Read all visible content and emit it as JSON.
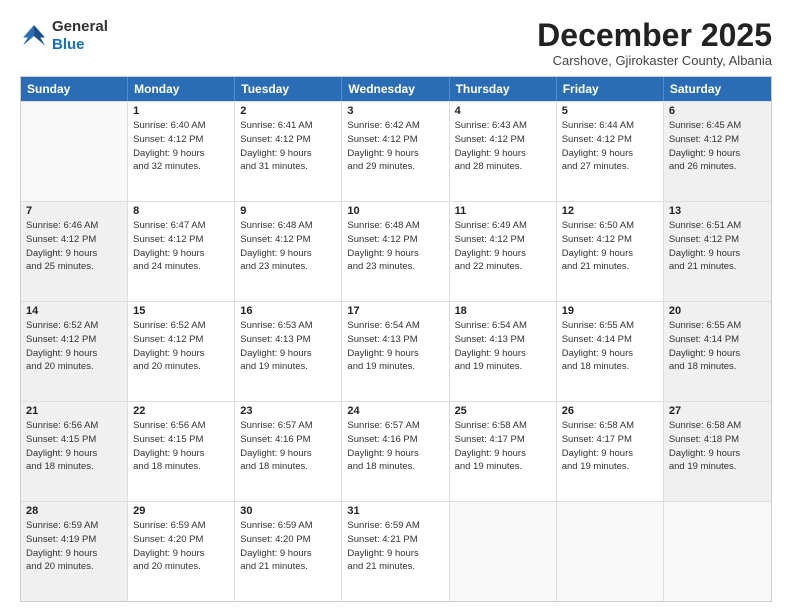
{
  "header": {
    "logo_general": "General",
    "logo_blue": "Blue",
    "month_title": "December 2025",
    "subtitle": "Carshove, Gjirokaster County, Albania"
  },
  "weekdays": [
    "Sunday",
    "Monday",
    "Tuesday",
    "Wednesday",
    "Thursday",
    "Friday",
    "Saturday"
  ],
  "rows": [
    [
      {
        "num": "",
        "info": "",
        "empty": true
      },
      {
        "num": "1",
        "info": "Sunrise: 6:40 AM\nSunset: 4:12 PM\nDaylight: 9 hours\nand 32 minutes."
      },
      {
        "num": "2",
        "info": "Sunrise: 6:41 AM\nSunset: 4:12 PM\nDaylight: 9 hours\nand 31 minutes."
      },
      {
        "num": "3",
        "info": "Sunrise: 6:42 AM\nSunset: 4:12 PM\nDaylight: 9 hours\nand 29 minutes."
      },
      {
        "num": "4",
        "info": "Sunrise: 6:43 AM\nSunset: 4:12 PM\nDaylight: 9 hours\nand 28 minutes."
      },
      {
        "num": "5",
        "info": "Sunrise: 6:44 AM\nSunset: 4:12 PM\nDaylight: 9 hours\nand 27 minutes."
      },
      {
        "num": "6",
        "info": "Sunrise: 6:45 AM\nSunset: 4:12 PM\nDaylight: 9 hours\nand 26 minutes.",
        "shaded": true
      }
    ],
    [
      {
        "num": "7",
        "info": "Sunrise: 6:46 AM\nSunset: 4:12 PM\nDaylight: 9 hours\nand 25 minutes.",
        "shaded": true
      },
      {
        "num": "8",
        "info": "Sunrise: 6:47 AM\nSunset: 4:12 PM\nDaylight: 9 hours\nand 24 minutes."
      },
      {
        "num": "9",
        "info": "Sunrise: 6:48 AM\nSunset: 4:12 PM\nDaylight: 9 hours\nand 23 minutes."
      },
      {
        "num": "10",
        "info": "Sunrise: 6:48 AM\nSunset: 4:12 PM\nDaylight: 9 hours\nand 23 minutes."
      },
      {
        "num": "11",
        "info": "Sunrise: 6:49 AM\nSunset: 4:12 PM\nDaylight: 9 hours\nand 22 minutes."
      },
      {
        "num": "12",
        "info": "Sunrise: 6:50 AM\nSunset: 4:12 PM\nDaylight: 9 hours\nand 21 minutes."
      },
      {
        "num": "13",
        "info": "Sunrise: 6:51 AM\nSunset: 4:12 PM\nDaylight: 9 hours\nand 21 minutes.",
        "shaded": true
      }
    ],
    [
      {
        "num": "14",
        "info": "Sunrise: 6:52 AM\nSunset: 4:12 PM\nDaylight: 9 hours\nand 20 minutes.",
        "shaded": true
      },
      {
        "num": "15",
        "info": "Sunrise: 6:52 AM\nSunset: 4:12 PM\nDaylight: 9 hours\nand 20 minutes."
      },
      {
        "num": "16",
        "info": "Sunrise: 6:53 AM\nSunset: 4:13 PM\nDaylight: 9 hours\nand 19 minutes."
      },
      {
        "num": "17",
        "info": "Sunrise: 6:54 AM\nSunset: 4:13 PM\nDaylight: 9 hours\nand 19 minutes."
      },
      {
        "num": "18",
        "info": "Sunrise: 6:54 AM\nSunset: 4:13 PM\nDaylight: 9 hours\nand 19 minutes."
      },
      {
        "num": "19",
        "info": "Sunrise: 6:55 AM\nSunset: 4:14 PM\nDaylight: 9 hours\nand 18 minutes."
      },
      {
        "num": "20",
        "info": "Sunrise: 6:55 AM\nSunset: 4:14 PM\nDaylight: 9 hours\nand 18 minutes.",
        "shaded": true
      }
    ],
    [
      {
        "num": "21",
        "info": "Sunrise: 6:56 AM\nSunset: 4:15 PM\nDaylight: 9 hours\nand 18 minutes.",
        "shaded": true
      },
      {
        "num": "22",
        "info": "Sunrise: 6:56 AM\nSunset: 4:15 PM\nDaylight: 9 hours\nand 18 minutes."
      },
      {
        "num": "23",
        "info": "Sunrise: 6:57 AM\nSunset: 4:16 PM\nDaylight: 9 hours\nand 18 minutes."
      },
      {
        "num": "24",
        "info": "Sunrise: 6:57 AM\nSunset: 4:16 PM\nDaylight: 9 hours\nand 18 minutes."
      },
      {
        "num": "25",
        "info": "Sunrise: 6:58 AM\nSunset: 4:17 PM\nDaylight: 9 hours\nand 19 minutes."
      },
      {
        "num": "26",
        "info": "Sunrise: 6:58 AM\nSunset: 4:17 PM\nDaylight: 9 hours\nand 19 minutes."
      },
      {
        "num": "27",
        "info": "Sunrise: 6:58 AM\nSunset: 4:18 PM\nDaylight: 9 hours\nand 19 minutes.",
        "shaded": true
      }
    ],
    [
      {
        "num": "28",
        "info": "Sunrise: 6:59 AM\nSunset: 4:19 PM\nDaylight: 9 hours\nand 20 minutes.",
        "shaded": true
      },
      {
        "num": "29",
        "info": "Sunrise: 6:59 AM\nSunset: 4:20 PM\nDaylight: 9 hours\nand 20 minutes."
      },
      {
        "num": "30",
        "info": "Sunrise: 6:59 AM\nSunset: 4:20 PM\nDaylight: 9 hours\nand 21 minutes."
      },
      {
        "num": "31",
        "info": "Sunrise: 6:59 AM\nSunset: 4:21 PM\nDaylight: 9 hours\nand 21 minutes."
      },
      {
        "num": "",
        "info": "",
        "empty": true
      },
      {
        "num": "",
        "info": "",
        "empty": true
      },
      {
        "num": "",
        "info": "",
        "empty": true,
        "shaded": true
      }
    ]
  ]
}
